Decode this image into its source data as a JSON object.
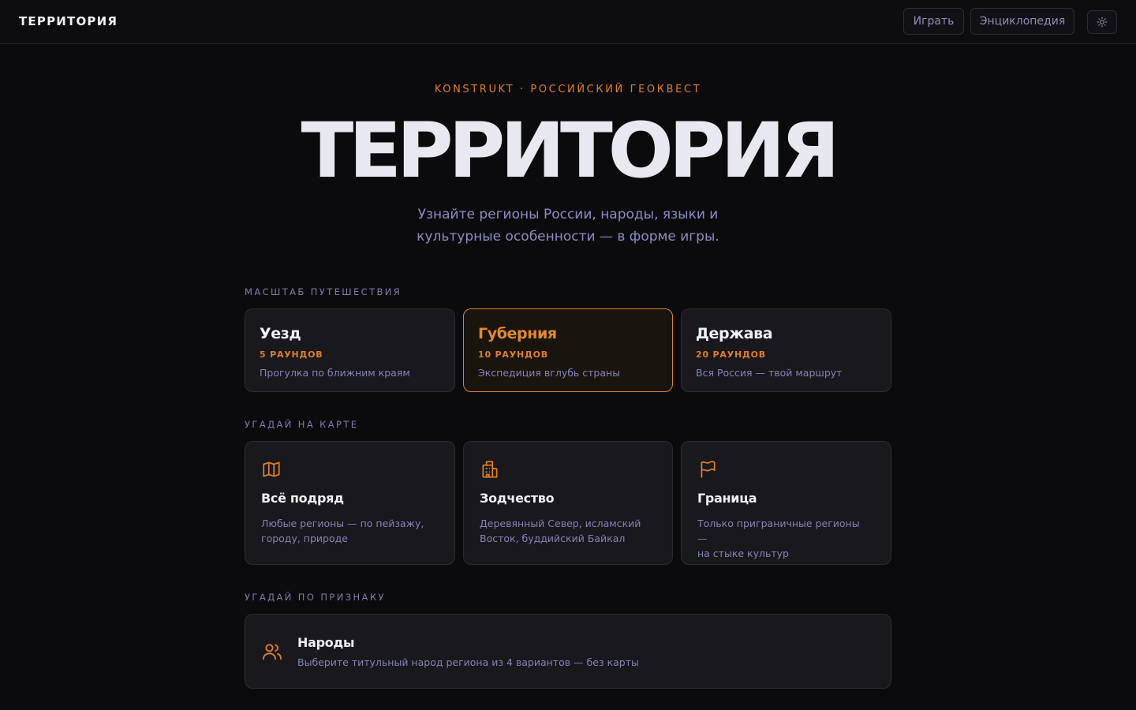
{
  "header": {
    "logo": "ТЕРРИТОРИЯ",
    "nav_play": "Играть",
    "nav_encyclopedia": "Энциклопедия",
    "theme_icon": "sun-icon"
  },
  "hero": {
    "eyebrow": "KONSTRUKT · РОССИЙСКИЙ ГЕОКВЕСТ",
    "title": "ТЕРРИТОРИЯ",
    "subtitle_line1": "Узнайте регионы России, народы, языки и",
    "subtitle_line2": "культурные особенности — в форме игры."
  },
  "scale": {
    "label": "МАСШТАБ ПУТЕШЕСТВИЯ",
    "items": [
      {
        "title": "Уезд",
        "rounds": "5 РАУНДОВ",
        "desc": "Прогулка по ближним краям",
        "selected": false
      },
      {
        "title": "Губерния",
        "rounds": "10 РАУНДОВ",
        "desc": "Экспедиция вглубь страны",
        "selected": true
      },
      {
        "title": "Держава",
        "rounds": "20 РАУНДОВ",
        "desc": "Вся Россия — твой маршрут",
        "selected": false
      }
    ]
  },
  "map_modes": {
    "label": "УГАДАЙ НА КАРТЕ",
    "items": [
      {
        "icon": "map-icon",
        "title": "Всё подряд",
        "desc_line1": "Любые регионы — по пейзажу,",
        "desc_line2": "городу, природе"
      },
      {
        "icon": "building-icon",
        "title": "Зодчество",
        "desc_line1": "Деревянный Север, исламский",
        "desc_line2": "Восток, буддийский Байкал"
      },
      {
        "icon": "flag-icon",
        "title": "Граница",
        "desc_line1": "Только приграничные регионы —",
        "desc_line2": "на стыке культур"
      }
    ]
  },
  "attr_modes": {
    "label": "УГАДАЙ ПО ПРИЗНАКУ",
    "people": {
      "icon": "users-icon",
      "title": "Народы",
      "desc": "Выберите титульный народ региона из 4 вариантов — без карты"
    }
  },
  "colors": {
    "accent": "#e07f24",
    "background": "#0b0b0d",
    "card": "#18181d",
    "muted_text": "#8484b4"
  }
}
